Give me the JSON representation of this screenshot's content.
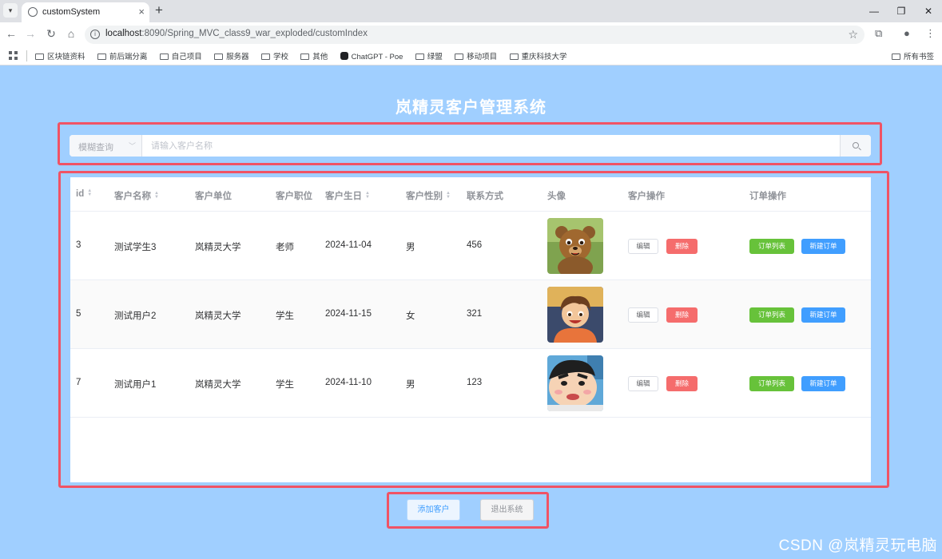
{
  "browser": {
    "tab_title": "customSystem",
    "url_host": "localhost",
    "url_path": ":8090/Spring_MVC_class9_war_exploded/customIndex",
    "bookmarks": [
      "区块链资料",
      "前后端分离",
      "自己项目",
      "服务器",
      "学校",
      "其他",
      "ChatGPT - Poe",
      "绿盟",
      "移动项目",
      "重庆科技大学"
    ],
    "all_bookmarks": "所有书签"
  },
  "page": {
    "title": "岚精灵客户管理系统"
  },
  "search": {
    "select_value": "模糊查询",
    "placeholder": "请输入客户名称"
  },
  "table": {
    "headers": [
      "id",
      "客户名称",
      "客户单位",
      "客户职位",
      "客户生日",
      "客户性别",
      "联系方式",
      "头像",
      "客户操作",
      "订单操作"
    ],
    "rows": [
      {
        "id": "3",
        "name": "测试学生3",
        "company": "岚精灵大学",
        "position": "老师",
        "birthday": "2024-11-04",
        "gender": "男",
        "contact": "456",
        "avatar": "bear-avatar"
      },
      {
        "id": "5",
        "name": "测试用户2",
        "company": "岚精灵大学",
        "position": "学生",
        "birthday": "2024-11-15",
        "gender": "女",
        "contact": "321",
        "avatar": "boy-avatar"
      },
      {
        "id": "7",
        "name": "测试用户1",
        "company": "岚精灵大学",
        "position": "学生",
        "birthday": "2024-11-10",
        "gender": "男",
        "contact": "123",
        "avatar": "cartoon-kid-avatar"
      }
    ],
    "actions": {
      "edit": "编辑",
      "delete": "删除",
      "order_list": "订单列表",
      "new_order": "新建订单"
    }
  },
  "footer": {
    "add_customer": "添加客户",
    "exit_system": "退出系统"
  },
  "watermark": "CSDN @岚精灵玩电脑",
  "colors": {
    "background": "#a0cfff",
    "highlight_box": "#f05365",
    "danger": "#f56c6c",
    "success": "#67c23a",
    "primary": "#409eff"
  }
}
